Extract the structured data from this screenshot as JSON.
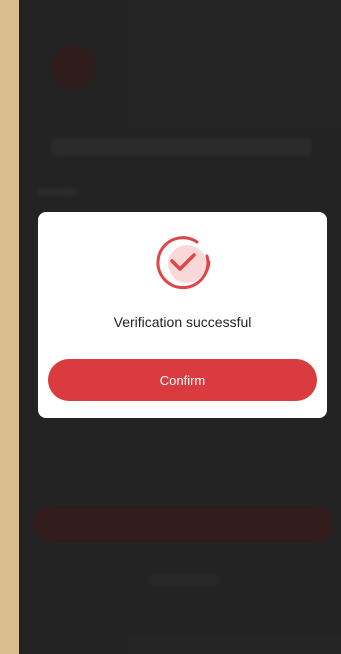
{
  "dialog": {
    "message": "Verification successful",
    "confirm_label": "Confirm",
    "icon": "check-circle-icon"
  },
  "colors": {
    "accent": "#d93b3f",
    "side_strip": "#fee0a8",
    "backdrop": "#2a2a2a"
  }
}
